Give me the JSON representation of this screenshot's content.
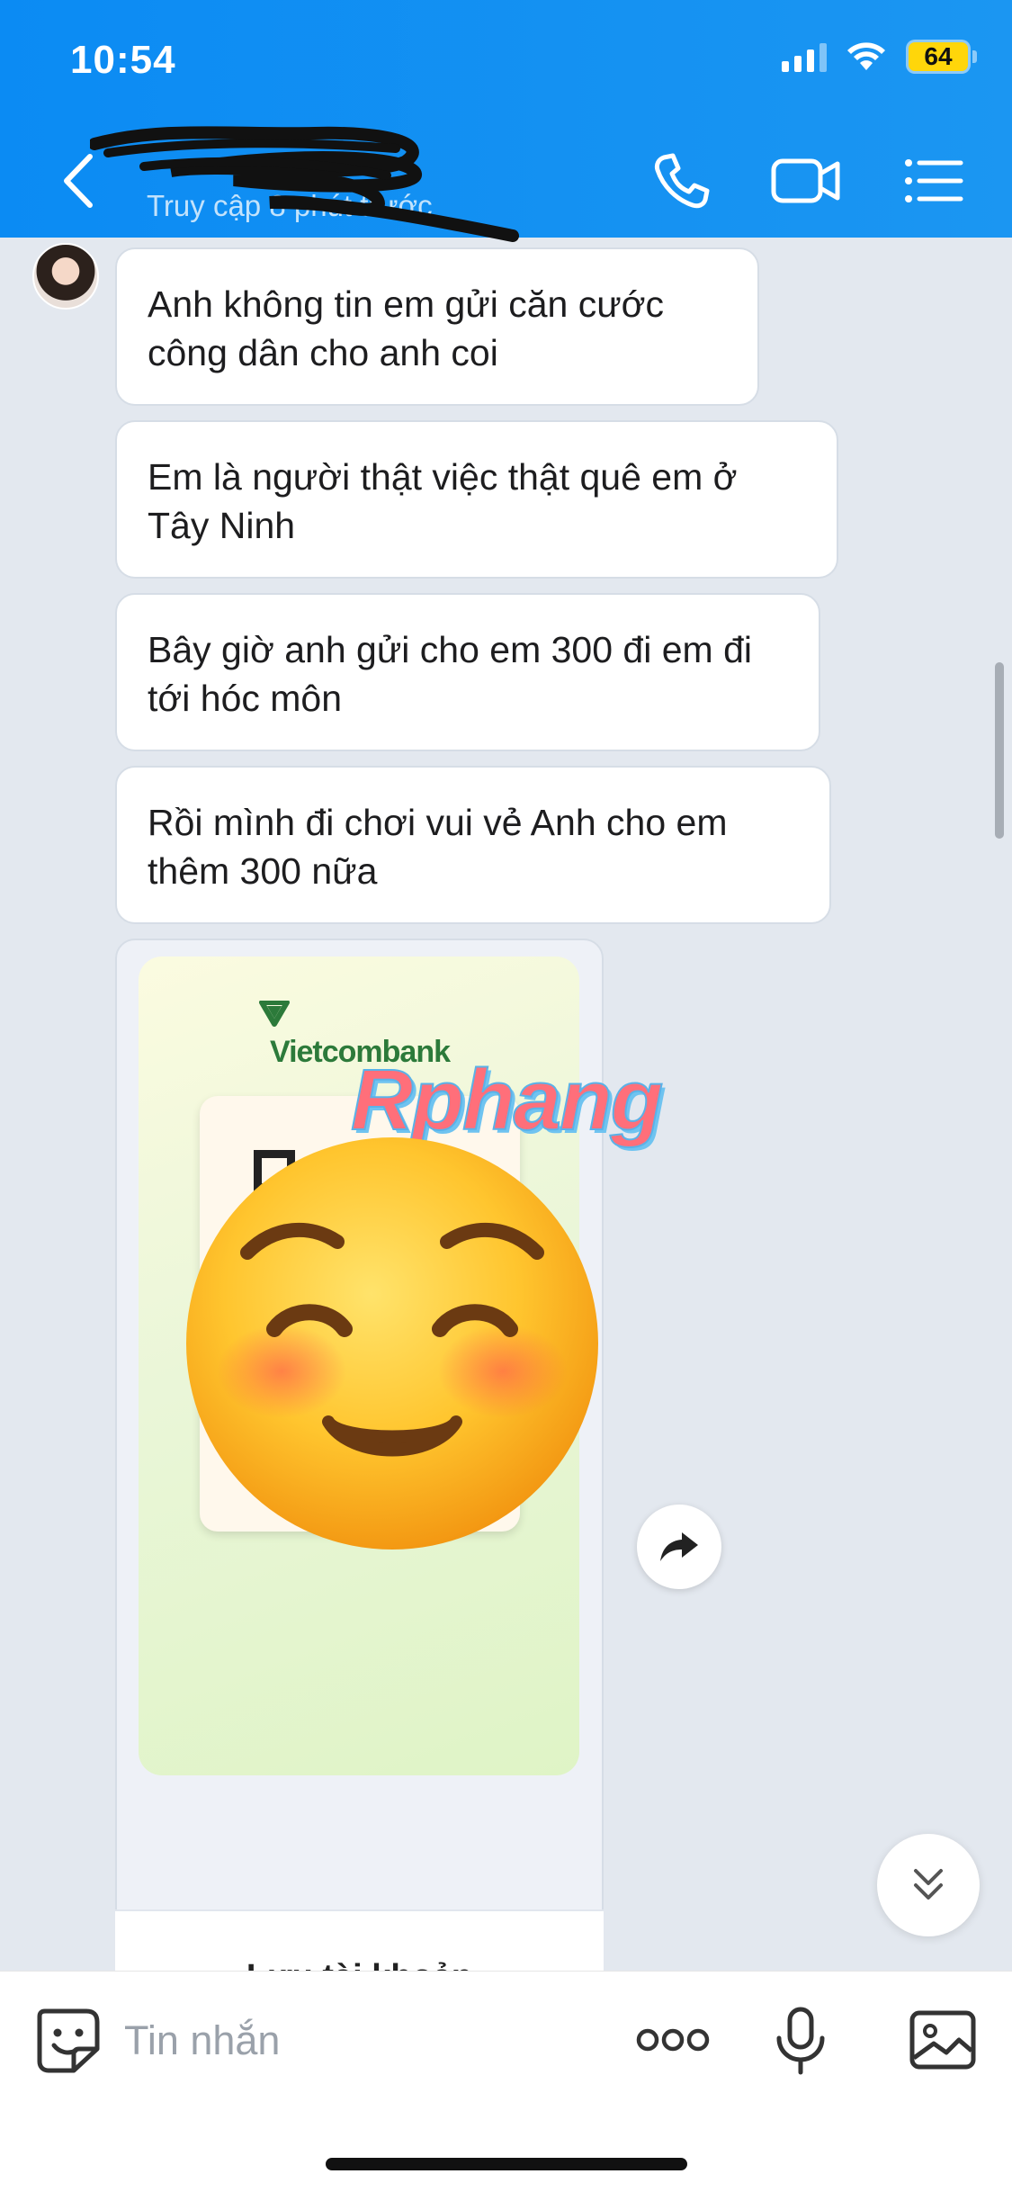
{
  "status_bar": {
    "time": "10:54",
    "battery": "64"
  },
  "header": {
    "contact_name": "",
    "last_seen": "Truy cập 8 phút trước",
    "icons": [
      "back-icon",
      "phone-icon",
      "video-call-icon",
      "list-menu-icon"
    ]
  },
  "messages": [
    {
      "text": "Anh không tin em gửi căn cước công dân cho anh coi"
    },
    {
      "text": "Em là người thật việc thật quê em ở Tây Ninh"
    },
    {
      "text": "Bây giờ anh gửi cho em 300 đi em đi tới hóc môn"
    },
    {
      "text": "Rồi mình đi chơi vui vẻ Anh cho em thêm 300 nữa"
    }
  ],
  "bank_card": {
    "bank_name": "Vietcombank",
    "watermark": "Rphang",
    "save_label": "Lưu tài khoản"
  },
  "input_bar": {
    "placeholder": "Tin nhắn",
    "icons": [
      "sticker-icon",
      "more-icon",
      "microphone-icon",
      "image-icon"
    ]
  },
  "colors": {
    "header": "#0b8bf3",
    "battery": "#ffd60a",
    "bank_green": "#2c7a3a"
  }
}
